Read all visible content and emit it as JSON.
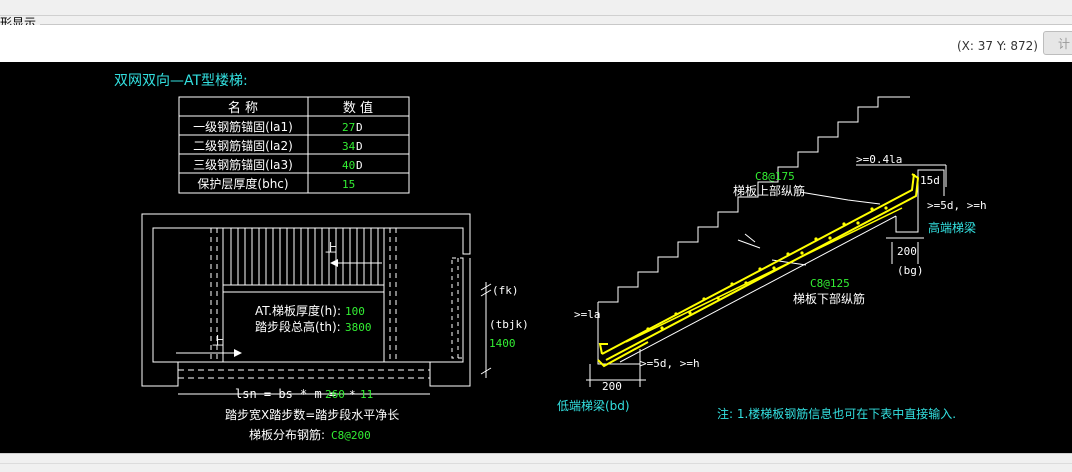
{
  "window": {
    "group_title": "形显示"
  },
  "toolbar": {
    "coordinates": "(X: 37 Y: 872)",
    "calc_button": "计"
  },
  "diagram": {
    "title": "双网双向—AT型楼梯:",
    "table": {
      "headers": [
        "名 称",
        "数 值"
      ],
      "rows": [
        {
          "name": "一级钢筋锚固(la1)",
          "value": "27",
          "unit": "D"
        },
        {
          "name": "二级钢筋锚固(la2)",
          "value": "34",
          "unit": "D"
        },
        {
          "name": "三级钢筋锚固(la3)",
          "value": "40",
          "unit": "D"
        },
        {
          "name": "保护层厚度(bhc)",
          "value": "15",
          "unit": ""
        }
      ]
    },
    "plan": {
      "up_label_top": "上",
      "up_label_bottom": "上",
      "thickness_label": "AT.梯板厚度(h):",
      "thickness_value": "100",
      "height_label": "踏步段总高(th):",
      "height_value": "3800",
      "fk_label": "(fk)",
      "tbjk_label": "(tbjk)",
      "tbjk_value": "1400",
      "lsn_formula": "lsn = bs * m =",
      "lsn_bs": "260",
      "lsn_mul": "*",
      "lsn_m": "11",
      "lsn_desc": "踏步宽X踏步数=踏步段水平净长",
      "dist_label": "梯板分布钢筋:",
      "dist_value": "C8@200"
    },
    "section": {
      "la_top": ">=0.4la",
      "top_15d": "15d",
      "top_rebar_code": "C8@175",
      "top_rebar_label": "梯板上部纵筋",
      "top_anchor": ">=5d, >=h",
      "high_beam": "高端梯梁",
      "bg_dim": "200",
      "bg_label": "(bg)",
      "bottom_rebar_code": "C8@125",
      "bottom_rebar_label": "梯板下部纵筋",
      "la_bottom": ">=la",
      "bottom_anchor": ">=5d, >=h",
      "bd_dim": "200",
      "low_beam": "低端梯梁(bd)"
    },
    "note": "注: 1.楼梯板钢筋信息也可在下表中直接输入."
  },
  "colors": {
    "canvas": "#000000",
    "cyan": "#33e0e0",
    "green": "#33ee33",
    "yellow": "#ffff00"
  }
}
